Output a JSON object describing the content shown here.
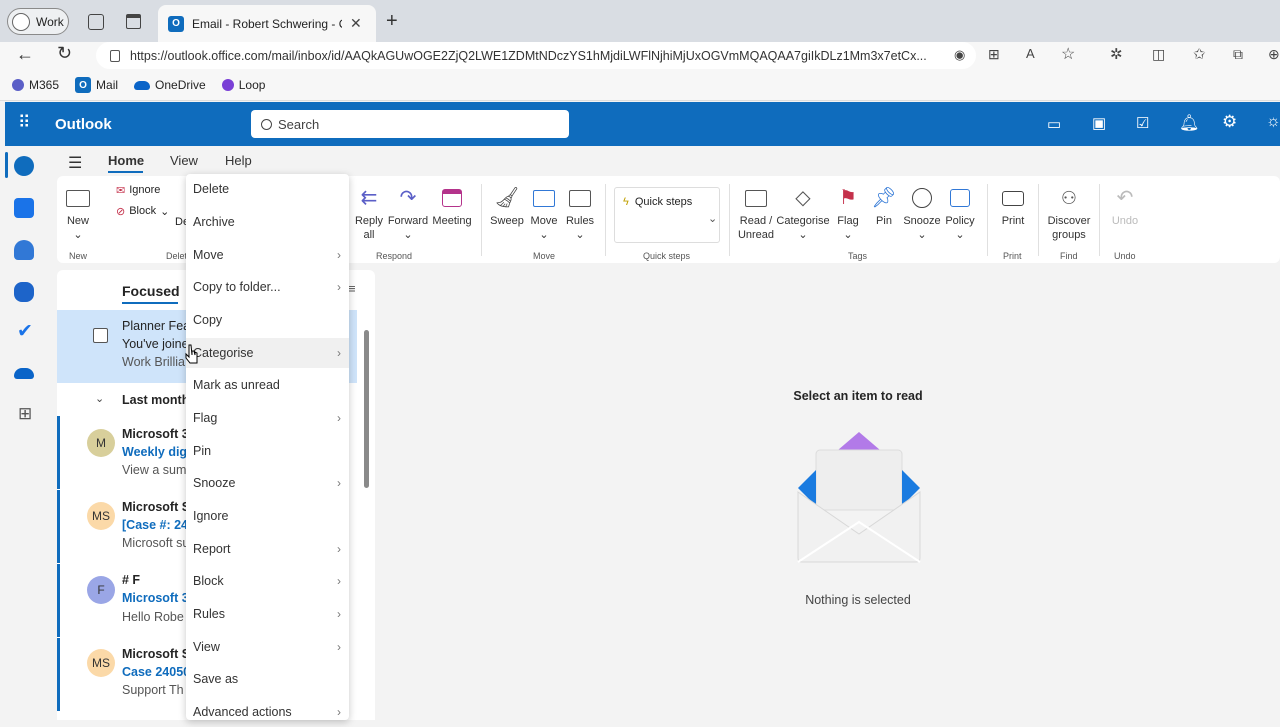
{
  "browser": {
    "profile": "Work",
    "tab_title": "Email - Robert Schwering - Outlo",
    "url": "https://outlook.office.com/mail/inbox/id/AAQkAGUwOGE2ZjQ2LWE1ZDMtNDczYS1hMjdiLWFlNjhiMjUxOGVmMQAQAA7giIkDLz1Mm3x7etCx...",
    "favorites": [
      {
        "label": "M365",
        "color": "#5b5fc7"
      },
      {
        "label": "Mail",
        "color": "#0f6cbd"
      },
      {
        "label": "OneDrive",
        "color": "#0a64c8"
      },
      {
        "label": "Loop",
        "color": "#7a3fd6"
      }
    ]
  },
  "app": {
    "name": "Outlook",
    "search_placeholder": "Search"
  },
  "menu_tabs": [
    "Home",
    "View",
    "Help"
  ],
  "ribbon": {
    "new": "New",
    "ignore": "Ignore",
    "block": "Block",
    "delete_partial": "De",
    "reply_all": "Reply all",
    "forward": "Forward",
    "meeting": "Meeting",
    "sweep": "Sweep",
    "move": "Move",
    "rules": "Rules",
    "quick_steps": "Quick steps",
    "read_unread": "Read / Unread",
    "categorise": "Categorise",
    "flag": "Flag",
    "pin": "Pin",
    "snooze": "Snooze",
    "policy": "Policy",
    "print": "Print",
    "discover_groups": "Discover groups",
    "undo": "Undo",
    "groups": {
      "new": "New",
      "delete": "Delet",
      "respond": "Respond",
      "move": "Move",
      "quick_steps": "Quick steps",
      "tags": "Tags",
      "print": "Print",
      "find": "Find",
      "undo": "Undo"
    }
  },
  "list": {
    "focused_tab": "Focused",
    "section_last_month": "Last month",
    "items": [
      {
        "sender": "Planner Fea",
        "subject": "You've joine",
        "preview": "Work Brillia",
        "avatar": ""
      },
      {
        "sender": "Microsoft 3",
        "subject": "Weekly dig",
        "preview": "View a sum",
        "avatar": "M"
      },
      {
        "sender": "Microsoft S",
        "subject": "[Case #: 24",
        "preview": "Microsoft su",
        "avatar": "MS"
      },
      {
        "sender": "# F",
        "subject": "Microsoft 3",
        "preview": "Hello Robe",
        "avatar": "F"
      },
      {
        "sender": "Microsoft S",
        "subject": "Case 24050",
        "preview": "Support Th",
        "avatar": "MS"
      }
    ]
  },
  "reading_pane": {
    "title": "Select an item to read",
    "subtitle": "Nothing is selected"
  },
  "context_menu": [
    {
      "label": "Delete",
      "submenu": false
    },
    {
      "label": "Archive",
      "submenu": false
    },
    {
      "label": "Move",
      "submenu": true
    },
    {
      "label": "Copy to folder...",
      "submenu": true
    },
    {
      "label": "Copy",
      "submenu": false
    },
    {
      "label": "Categorise",
      "submenu": true
    },
    {
      "label": "Mark as unread",
      "submenu": false
    },
    {
      "label": "Flag",
      "submenu": true
    },
    {
      "label": "Pin",
      "submenu": false
    },
    {
      "label": "Snooze",
      "submenu": true
    },
    {
      "label": "Ignore",
      "submenu": false
    },
    {
      "label": "Report",
      "submenu": true
    },
    {
      "label": "Block",
      "submenu": true
    },
    {
      "label": "Rules",
      "submenu": true
    },
    {
      "label": "View",
      "submenu": true
    },
    {
      "label": "Save as",
      "submenu": false
    },
    {
      "label": "Advanced actions",
      "submenu": true
    }
  ],
  "colors": {
    "brand": "#0f6cbd",
    "selected_row": "#cfe4fa",
    "unread_bar": "#0f6cbd"
  }
}
